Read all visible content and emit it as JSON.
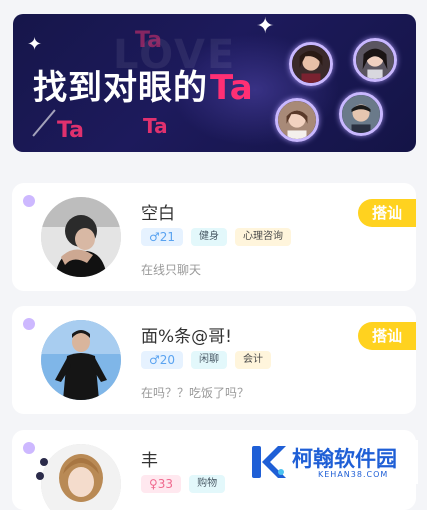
{
  "banner": {
    "title_main": "找到对眼的",
    "title_accent": "Ta",
    "deco_text": "Ta",
    "bg_word": "LOVE",
    "accent_color": "#ff2f74"
  },
  "users": [
    {
      "name": "空白",
      "gender_symbol": "♂",
      "age": "21",
      "tags": [
        "健身",
        "心理咨询"
      ],
      "status": "在线只聊天",
      "action_label": "搭讪"
    },
    {
      "name": "面%条@哥!",
      "gender_symbol": "♂",
      "age": "20",
      "tags": [
        "闲聊",
        "会计"
      ],
      "status": "在吗？？吃饭了吗？",
      "action_label": "搭讪"
    },
    {
      "name": "丰",
      "gender_symbol": "♀",
      "age": "33",
      "tags": [
        "购物"
      ],
      "status": "",
      "action_label": ""
    }
  ],
  "watermark": {
    "name": "柯翰软件园",
    "domain": "KEHAN38.COM",
    "color": "#1f5fd6"
  }
}
